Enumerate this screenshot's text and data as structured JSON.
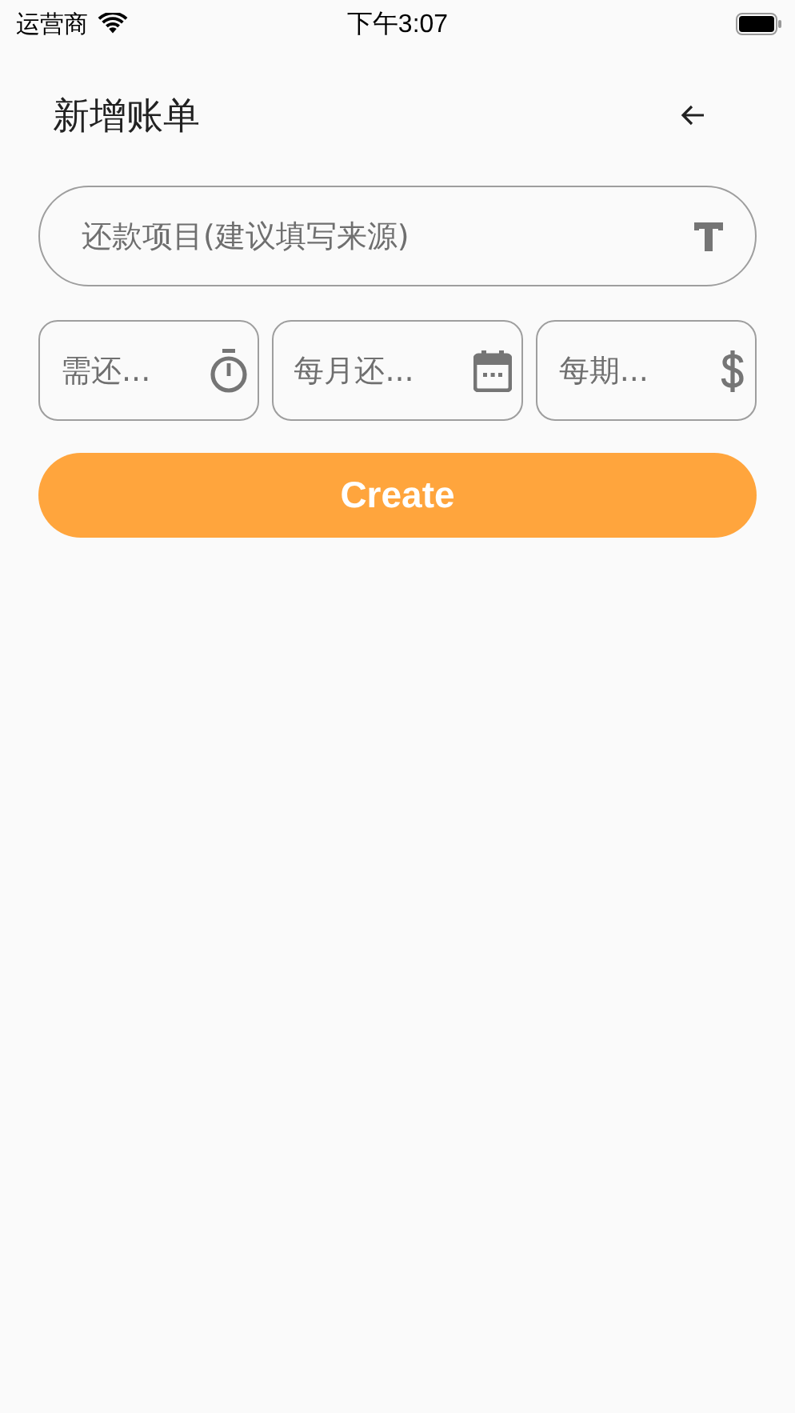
{
  "status_bar": {
    "carrier": "运营商",
    "time": "下午3:07"
  },
  "header": {
    "title": "新增账单"
  },
  "form": {
    "title_field": {
      "placeholder": "还款项目(建议填写来源)"
    },
    "fields": [
      {
        "placeholder": "需还..."
      },
      {
        "placeholder": "每月还..."
      },
      {
        "placeholder": "每期..."
      }
    ],
    "submit": "Create"
  }
}
